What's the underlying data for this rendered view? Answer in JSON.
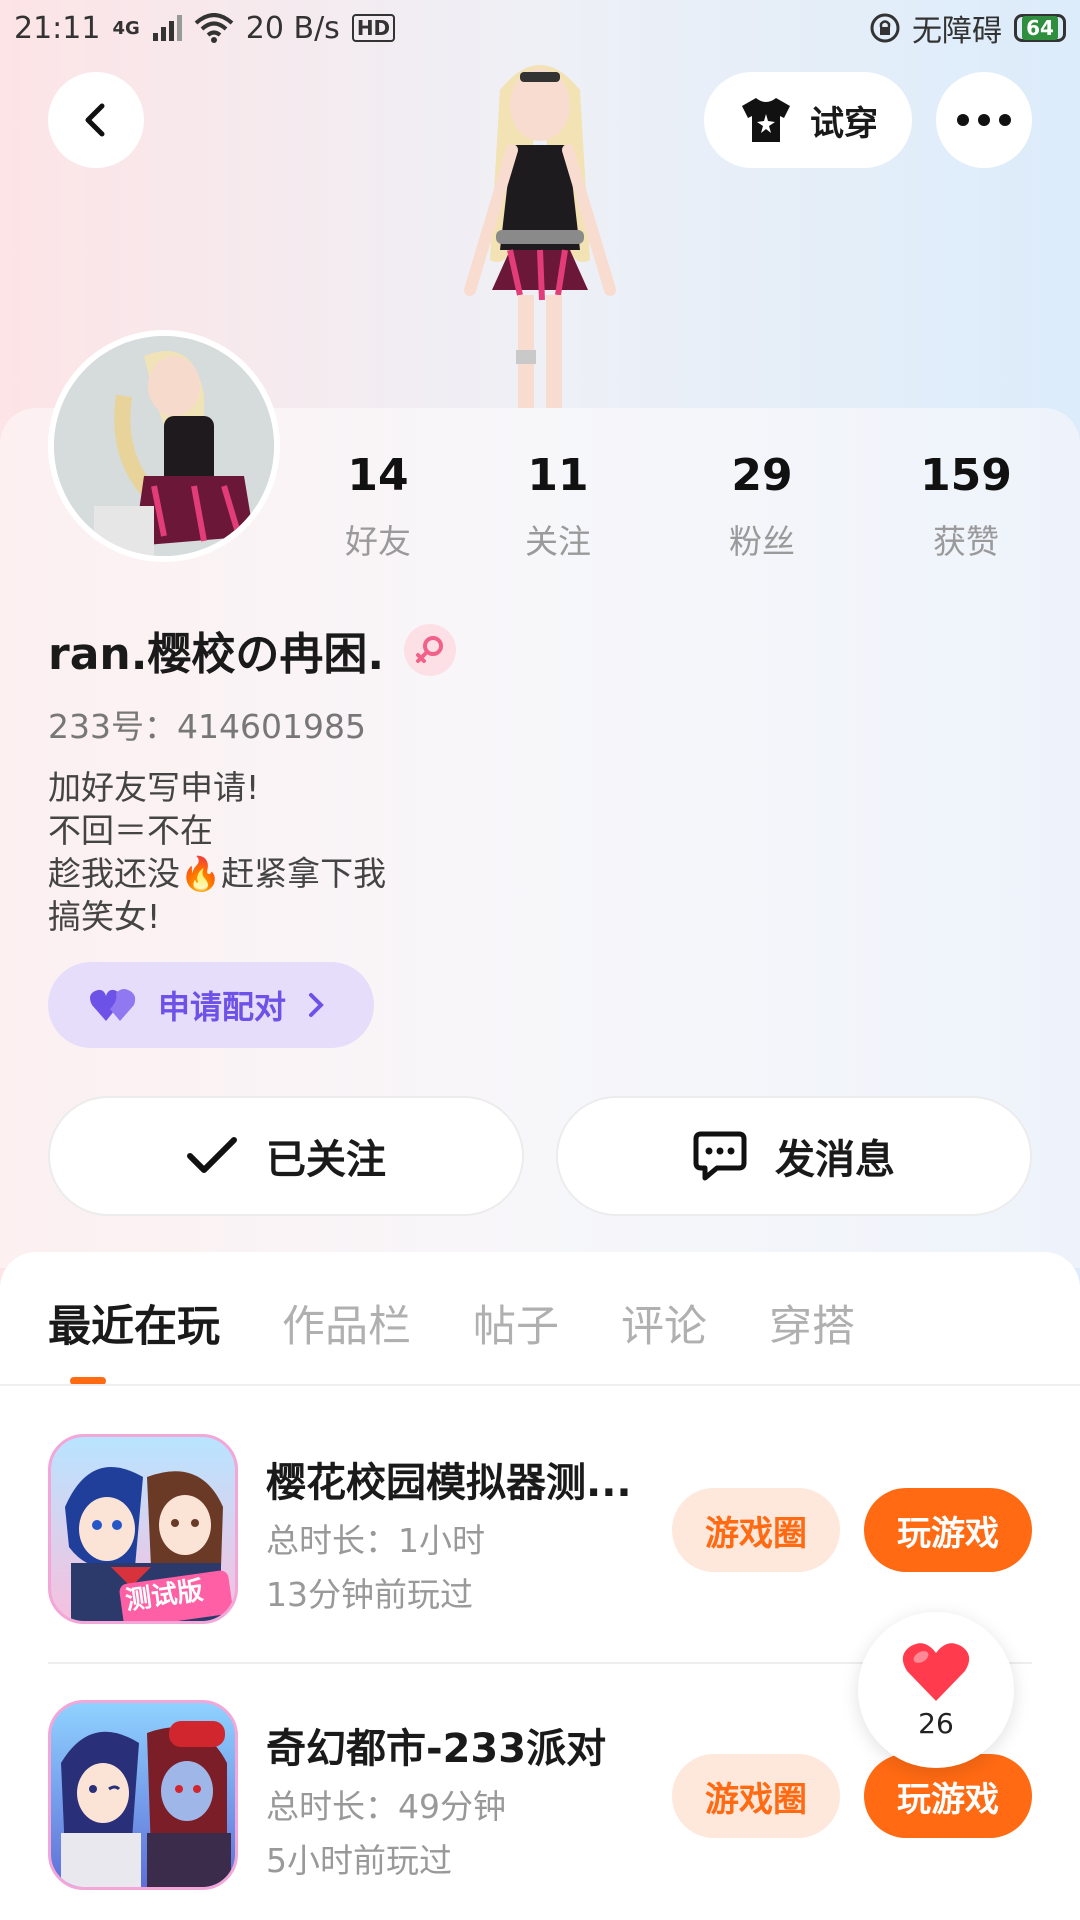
{
  "status_bar": {
    "time": "21:11",
    "network": "4G",
    "speed": "20 B/s",
    "hd": "HD",
    "accessibility": "无障碍",
    "battery": "64"
  },
  "header": {
    "back_icon": "chevron-left-icon",
    "tryon_label": "试穿",
    "more_icon": "more-dots-icon"
  },
  "profile": {
    "stats": [
      {
        "value": "14",
        "label": "好友"
      },
      {
        "value": "11",
        "label": "关注"
      },
      {
        "value": "29",
        "label": "粉丝"
      },
      {
        "value": "159",
        "label": "获赞"
      }
    ],
    "username": "ran.樱校の冉困.",
    "gender_icon": "female-icon",
    "uid": "233号：414601985",
    "bio_lines": [
      "加好友写申请!",
      "不回＝不在",
      "趁我还没🔥赶紧拿下我",
      "搞笑女!"
    ],
    "match_label": "申请配对",
    "follow_label": "已关注",
    "message_label": "发消息"
  },
  "tabs": [
    {
      "label": "最近在玩",
      "active": true
    },
    {
      "label": "作品栏",
      "active": false
    },
    {
      "label": "帖子",
      "active": false
    },
    {
      "label": "评论",
      "active": false
    },
    {
      "label": "穿搭",
      "active": false
    }
  ],
  "games": [
    {
      "title": "樱花校园模拟器测...",
      "duration": "总时长：1小时",
      "last_played": "13分钟前玩过",
      "circle_label": "游戏圈",
      "play_label": "玩游戏",
      "icon_badge": "测试版"
    },
    {
      "title": "奇幻都市-233派对",
      "duration": "总时长：49分钟",
      "last_played": "5小时前玩过",
      "circle_label": "游戏圈",
      "play_label": "玩游戏"
    }
  ],
  "like_float": {
    "count": "26"
  },
  "colors": {
    "accent": "#ff6a13",
    "match_purple": "#6d52e8",
    "heart_red": "#ff3b4d"
  }
}
